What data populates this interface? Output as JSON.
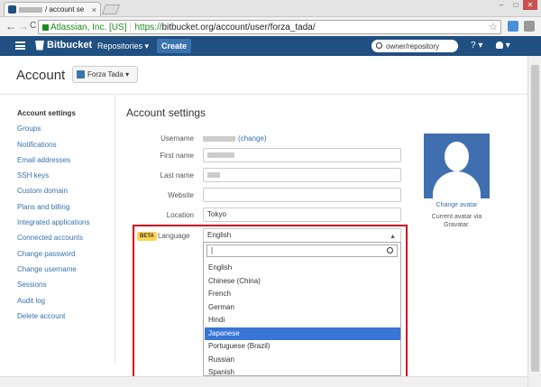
{
  "browser": {
    "tab_title": "/ account se",
    "tab_close": "×",
    "win_min": "–",
    "win_max": "□",
    "win_close": "✕",
    "back": "←",
    "forward": "→",
    "reload": "C",
    "ev_org": "Atlassian, Inc. [US]",
    "url_scheme": "https://",
    "url_rest": "bitbucket.org/account/user/forza_tada/",
    "star": "☆"
  },
  "header": {
    "logo": "Bitbucket",
    "repositories": "Repositories ▾",
    "create": "Create",
    "search_placeholder": "owner/repository",
    "help": "? ▾",
    "user": "▾"
  },
  "account": {
    "title": "Account",
    "switch_label": "Forza Tada ▾"
  },
  "sidebar": {
    "items": [
      "Account settings",
      "Groups",
      "Notifications",
      "Email addresses",
      "SSH keys",
      "Custom domain",
      "Plans and billing",
      "Integrated applications",
      "Connected accounts",
      "Change password",
      "Change username",
      "Sessions",
      "Audit log",
      "Delete account"
    ]
  },
  "main": {
    "title": "Account settings",
    "username_label": "Username",
    "username_change": "(change)",
    "first_name_label": "First name",
    "last_name_label": "Last name",
    "website_label": "Website",
    "location_label": "Location",
    "location_value": "Tokyo",
    "beta": "BETA",
    "language_label": "Language",
    "language_value": "English",
    "language_caret": "▲"
  },
  "avatar": {
    "change": "Change avatar",
    "note": "Current avatar via Gravatar."
  },
  "dropdown": {
    "search_value": "|",
    "options": [
      "English",
      "Chinese (China)",
      "French",
      "German",
      "Hindi",
      "Japanese",
      "Portuguese (Brazil)",
      "Russian",
      "Spanish"
    ],
    "highlighted": "Japanese"
  },
  "colors": {
    "header_bg": "#205081",
    "link": "#3572b0",
    "highlight": "#3875d7",
    "annotation_red": "#d0021b"
  }
}
